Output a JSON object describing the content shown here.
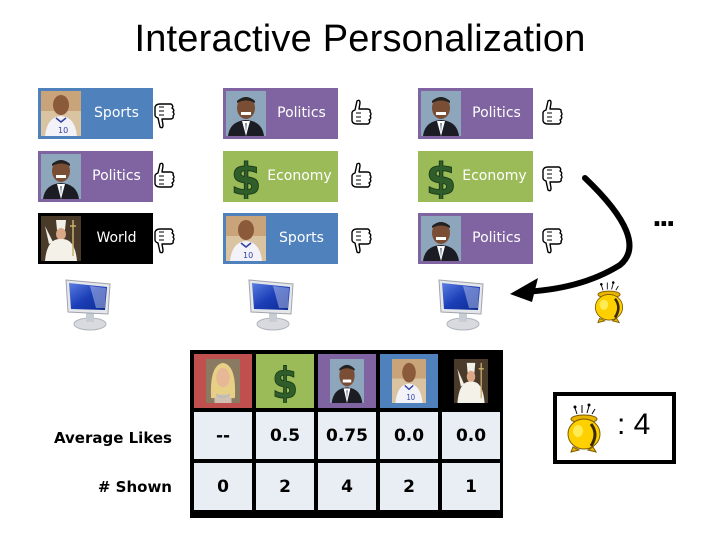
{
  "title": "Interactive Personalization",
  "colors": {
    "sports": "#4f81bd",
    "politics": "#8064a2",
    "economy": "#9bbb59",
    "world": "#000000",
    "entertainment": "#c0504d",
    "table_cell": "#e9edf4",
    "pot_gold": "#f5c400"
  },
  "users": [
    {
      "icon": "monitor-icon",
      "articles": [
        {
          "category": "Sports",
          "thumb": "soccer-player-photo",
          "feedback": "thumbs-down"
        },
        {
          "category": "Politics",
          "thumb": "politician-photo",
          "feedback": "thumbs-up"
        },
        {
          "category": "World",
          "thumb": "pope-photo",
          "feedback": "thumbs-down"
        }
      ]
    },
    {
      "icon": "monitor-icon",
      "articles": [
        {
          "category": "Politics",
          "thumb": "politician-photo",
          "feedback": "thumbs-up"
        },
        {
          "category": "Economy",
          "thumb": "dollar-sign-icon",
          "feedback": "thumbs-up"
        },
        {
          "category": "Sports",
          "thumb": "soccer-player-photo",
          "feedback": "thumbs-down"
        }
      ]
    },
    {
      "icon": "monitor-icon",
      "articles": [
        {
          "category": "Politics",
          "thumb": "politician-photo",
          "feedback": "thumbs-up"
        },
        {
          "category": "Economy",
          "thumb": "dollar-sign-icon",
          "feedback": "thumbs-down"
        },
        {
          "category": "Politics",
          "thumb": "politician-photo",
          "feedback": "thumbs-down"
        }
      ]
    }
  ],
  "ellipsis": "...",
  "stats_table": {
    "columns": [
      {
        "category": "Entertainment",
        "thumb": "celebrity-photo"
      },
      {
        "category": "Economy",
        "thumb": "dollar-sign-icon"
      },
      {
        "category": "Politics",
        "thumb": "politician-photo"
      },
      {
        "category": "Sports",
        "thumb": "soccer-player-photo"
      },
      {
        "category": "World",
        "thumb": "pope-photo"
      }
    ],
    "rows": [
      {
        "label": "Average Likes",
        "values": [
          "--",
          "0.5",
          "0.75",
          "0.0",
          "0.0"
        ]
      },
      {
        "label": "# Shown",
        "values": [
          "0",
          "2",
          "4",
          "2",
          "1"
        ]
      }
    ]
  },
  "reward": {
    "icon": "pot-of-gold-icon",
    "text": ": 4"
  }
}
